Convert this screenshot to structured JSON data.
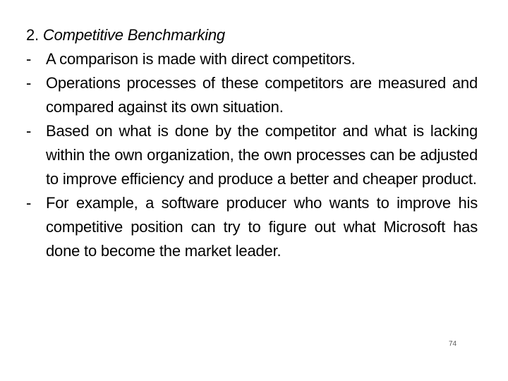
{
  "slide": {
    "heading": {
      "number": "2.",
      "title": "Competitive Benchmarking"
    },
    "bullets": [
      {
        "marker": "-",
        "text": "A comparison is made with direct competitors."
      },
      {
        "marker": "-",
        "text": "Operations processes of these competitors are measured and compared against its own situation."
      },
      {
        "marker": "-",
        "text": " Based on what is done by the competitor and what is lacking within the own organization, the own processes can be adjusted to improve efficiency and produce a better and cheaper product."
      },
      {
        "marker": "-",
        "text": "For example, a software producer who wants to improve his competitive position can try to figure out what Microsoft has done to become the market leader."
      }
    ],
    "page_number": "74"
  }
}
